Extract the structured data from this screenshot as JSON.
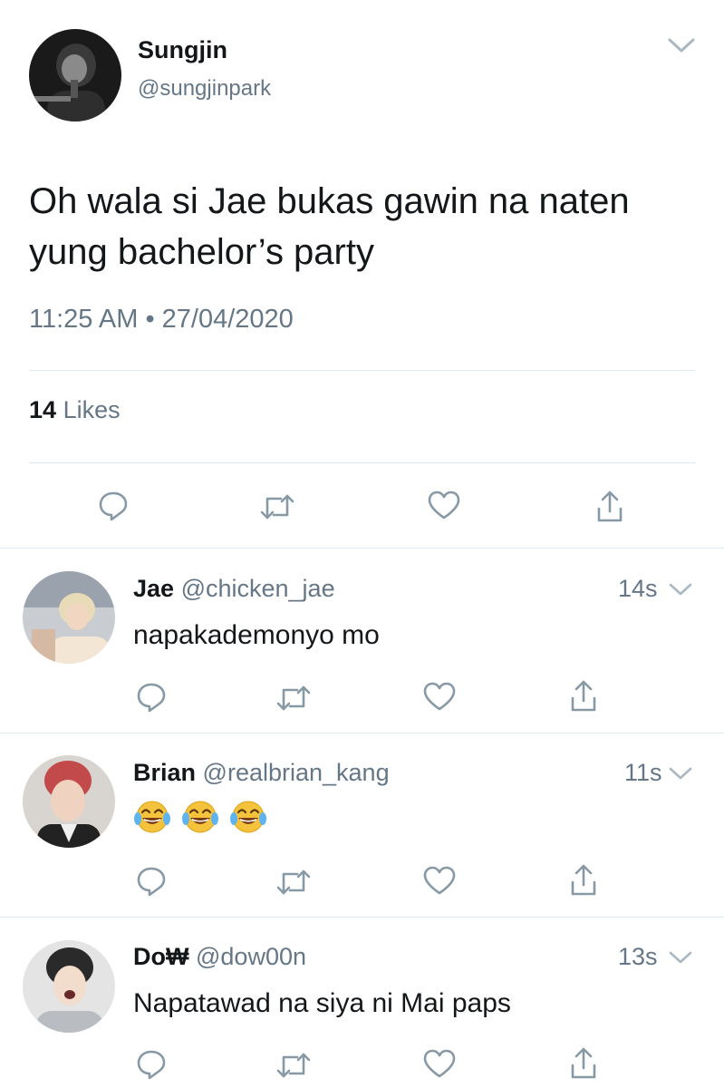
{
  "main_tweet": {
    "display_name": "Sungjin",
    "handle": "@sungjinpark",
    "text_line1": "Oh wala si Jae bukas gawin na naten",
    "text_line2": "yung bachelor’s party",
    "time": "11:25 AM",
    "separator": "•",
    "date": "27/04/2020",
    "likes_count": "14",
    "likes_label": "Likes"
  },
  "replies": [
    {
      "display_name": "Jae",
      "handle": "@chicken_jae",
      "age": "14s",
      "text": "napakademonyo mo"
    },
    {
      "display_name": "Brian",
      "handle": "@realbrian_kang",
      "age": "11s",
      "text": "😂😂😂"
    },
    {
      "display_name": "Do₩",
      "handle": "@dow00n",
      "age": "13s",
      "text": "Napatawad na siya ni Mai paps"
    }
  ],
  "icons": {
    "reply": "reply-icon",
    "retweet": "retweet-icon",
    "like": "like-icon",
    "share": "share-icon",
    "menu": "chevron-down-icon"
  },
  "colors": {
    "text": "#14171a",
    "secondary": "#657786",
    "divider": "#e1e8ed",
    "emoji": "#f5c33b"
  }
}
